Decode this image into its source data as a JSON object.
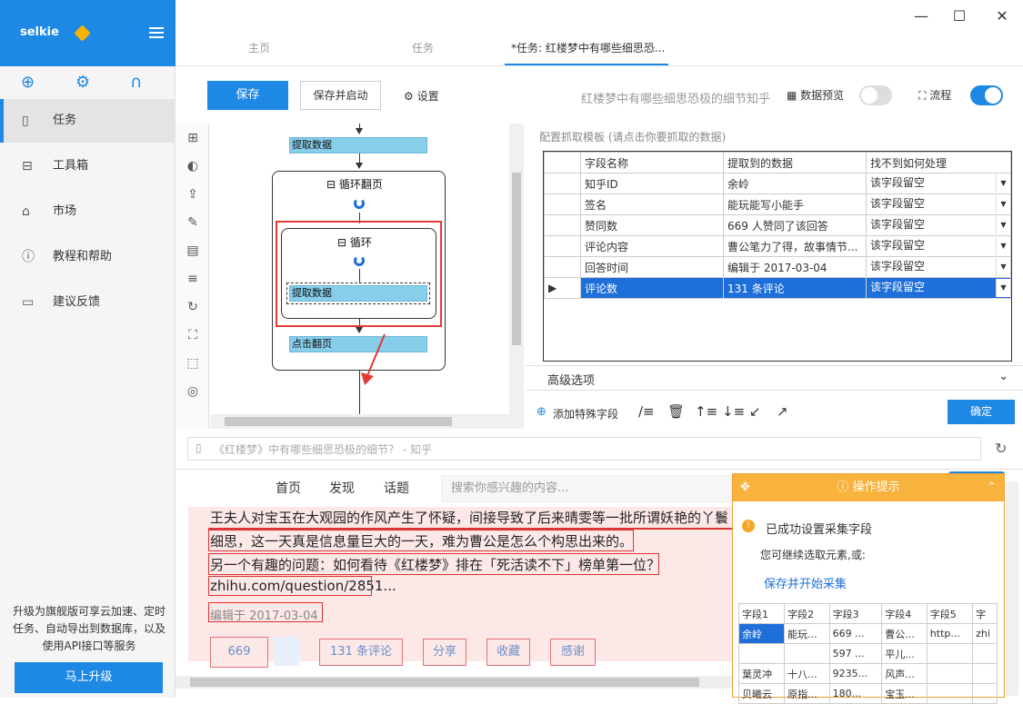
{
  "app": {
    "name": "selkie"
  },
  "sidebar": {
    "items": [
      {
        "label": "任务",
        "icon": "document-icon"
      },
      {
        "label": "工具箱",
        "icon": "toolbox-icon"
      },
      {
        "label": "市场",
        "icon": "lock-icon"
      },
      {
        "label": "教程和帮助",
        "icon": "help-icon"
      },
      {
        "label": "建议反馈",
        "icon": "feedback-icon"
      }
    ],
    "upgrade_text": "升级为旗舰版可享云加速、定时任务、自动导出到数据库，以及使用API接口等服务",
    "upgrade_button": "马上升级"
  },
  "tabs": [
    {
      "label": "主页"
    },
    {
      "label": "任务"
    },
    {
      "label": "*任务: 红楼梦中有哪些细思恐..."
    }
  ],
  "toolbar": {
    "save": "保存",
    "save_start": "保存并启动",
    "settings": "设置",
    "task_title": "红楼梦中有哪些细思恐极的细节知乎",
    "data_preview": "数据预览",
    "flow": "流程"
  },
  "flow": {
    "node_extract_top": "提取数据",
    "loop_page": "循环翻页",
    "loop": "循环",
    "node_extract_inner": "提取数据",
    "node_click_next": "点击翻页"
  },
  "config": {
    "title": "配置抓取模板 (请点击你要抓取的数据)",
    "headers": [
      "字段名称",
      "提取到的数据",
      "找不到如何处理"
    ],
    "rows": [
      {
        "name": "知乎ID",
        "value": "余岭",
        "handle": "该字段留空"
      },
      {
        "name": "签名",
        "value": "能玩能写小能手",
        "handle": "该字段留空"
      },
      {
        "name": "赞同数",
        "value": "669 人赞同了该回答",
        "handle": "该字段留空"
      },
      {
        "name": "评论内容",
        "value": "曹公笔力了得，故事情节...",
        "handle": "该字段留空"
      },
      {
        "name": "回答时间",
        "value": "编辑于 2017-03-04",
        "handle": "该字段留空"
      },
      {
        "name": "评论数",
        "value": "131 条评论",
        "handle": "该字段留空"
      }
    ],
    "advanced": "高级选项",
    "add_field": "添加特殊字段",
    "ok": "确定"
  },
  "browser": {
    "address": "《红楼梦》中有哪些细思恐极的细节？ - 知乎",
    "nav": [
      "首页",
      "发现",
      "话题"
    ],
    "search_placeholder": "搜索你感兴趣的内容...",
    "lines": [
      "王夫人对宝玉在大观园的作风产生了怀疑，间接导致了后来晴雯等一批所谓妖艳的丫鬟",
      "细思，这一天真是信息量巨大的一天，难为曹公是怎么个构思出来的。",
      "另一个有趣的问题：如何看待《红楼梦》排在「死活读不下」榜单第一位？",
      "zhihu.com/question/2851...",
      "编辑于 2017-03-04"
    ],
    "actions": [
      "669",
      "131 条评论",
      "分享",
      "收藏",
      "感谢"
    ]
  },
  "hint": {
    "title": "操作提示",
    "success": "已成功设置采集字段",
    "sub": "您可继续选取元素,或:",
    "link": "保存并开始采集",
    "headers": [
      "字段1",
      "字段2",
      "字段3",
      "字段4",
      "字段5",
      "字"
    ],
    "rows": [
      [
        "余岭",
        "能玩...",
        "669 ...",
        "曹公...",
        "http...",
        "zhi"
      ],
      [
        "",
        "",
        "597 ...",
        "平儿...",
        "",
        ""
      ],
      [
        "葉灵冲",
        "十八...",
        "9235...",
        "风声...",
        "",
        ""
      ],
      [
        "贝曦云",
        "原指...",
        "180...",
        "宝玉...",
        "",
        ""
      ]
    ]
  },
  "colors": {
    "accent": "#1e88e5",
    "node": "#87ceeb",
    "highlight": "#e53935",
    "hint": "#f8b33c"
  }
}
